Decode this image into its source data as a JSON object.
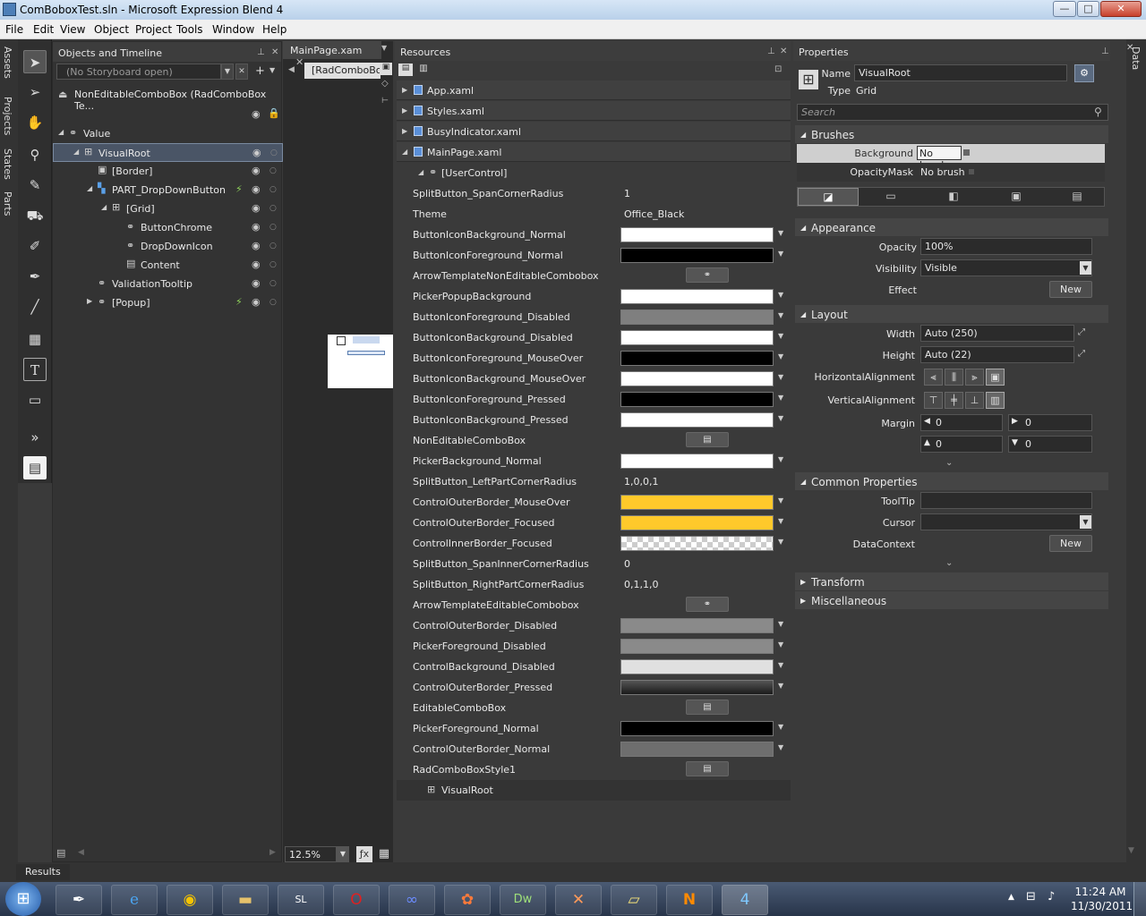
{
  "window": {
    "title": "ComBoboxTest.sln - Microsoft Expression Blend 4",
    "min": "—",
    "max": "□",
    "close": "✕"
  },
  "menu": [
    "File",
    "Edit",
    "View",
    "Object",
    "Project",
    "Tools",
    "Window",
    "Help"
  ],
  "left_tabs": [
    "Assets",
    "Projects",
    "States",
    "Parts"
  ],
  "right_tabs": [
    "Data"
  ],
  "objects": {
    "title": "Objects and Timeline",
    "storyboard": "(No Storyboard open)",
    "scope": "NonEditableComboBox (RadComboBox Te...",
    "tree": [
      {
        "label": "Value"
      },
      {
        "label": "VisualRoot"
      },
      {
        "label": "[Border]"
      },
      {
        "label": "PART_DropDownButton"
      },
      {
        "label": "[Grid]"
      },
      {
        "label": "ButtonChrome"
      },
      {
        "label": "DropDownIcon"
      },
      {
        "label": "Content"
      },
      {
        "label": "ValidationTooltip"
      },
      {
        "label": "[Popup]"
      }
    ]
  },
  "document": {
    "tab": "MainPage.xam",
    "breadcrumb": "[RadComboBo",
    "zoom": "12.5%"
  },
  "resources": {
    "title": "Resources",
    "files": [
      "App.xaml",
      "Styles.xaml",
      "BusyIndicator.xaml",
      "MainPage.xaml"
    ],
    "usercontrol": "[UserControl]",
    "rows": [
      {
        "key": "SplitButton_SpanCornerRadius",
        "kind": "text",
        "value": "1"
      },
      {
        "key": "Theme",
        "kind": "text",
        "value": "Office_Black"
      },
      {
        "key": "ButtonIconBackground_Normal",
        "kind": "swatch",
        "color": "#ffffff"
      },
      {
        "key": "ButtonIconForeground_Normal",
        "kind": "swatch",
        "color": "#000000"
      },
      {
        "key": "ArrowTemplateNonEditableCombobox",
        "kind": "button",
        "value": "⚭"
      },
      {
        "key": "PickerPopupBackground",
        "kind": "swatch",
        "color": "#ffffff"
      },
      {
        "key": "ButtonIconForeground_Disabled",
        "kind": "swatch",
        "color": "#7f7f7f"
      },
      {
        "key": "ButtonIconBackground_Disabled",
        "kind": "swatch",
        "color": "#ffffff"
      },
      {
        "key": "ButtonIconForeground_MouseOver",
        "kind": "swatch",
        "color": "#000000"
      },
      {
        "key": "ButtonIconBackground_MouseOver",
        "kind": "swatch",
        "color": "#ffffff"
      },
      {
        "key": "ButtonIconForeground_Pressed",
        "kind": "swatch",
        "color": "#000000"
      },
      {
        "key": "ButtonIconBackground_Pressed",
        "kind": "swatch",
        "color": "#ffffff"
      },
      {
        "key": "NonEditableComboBox",
        "kind": "button",
        "value": "▤"
      },
      {
        "key": "PickerBackground_Normal",
        "kind": "swatch",
        "color": "#ffffff"
      },
      {
        "key": "SplitButton_LeftPartCornerRadius",
        "kind": "text",
        "value": "1,0,0,1"
      },
      {
        "key": "ControlOuterBorder_MouseOver",
        "kind": "swatch",
        "color": "#ffc92b"
      },
      {
        "key": "ControlOuterBorder_Focused",
        "kind": "swatch",
        "color": "#ffc92b"
      },
      {
        "key": "ControlInnerBorder_Focused",
        "kind": "checker",
        "color": "transparent"
      },
      {
        "key": "SplitButton_SpanInnerCornerRadius",
        "kind": "text",
        "value": "0"
      },
      {
        "key": "SplitButton_RightPartCornerRadius",
        "kind": "text",
        "value": "0,1,1,0"
      },
      {
        "key": "ArrowTemplateEditableCombobox",
        "kind": "button",
        "value": "⚭"
      },
      {
        "key": "ControlOuterBorder_Disabled",
        "kind": "swatch",
        "color": "#8a8a8a"
      },
      {
        "key": "PickerForeground_Disabled",
        "kind": "swatch",
        "color": "#8a8a8a"
      },
      {
        "key": "ControlBackground_Disabled",
        "kind": "swatch",
        "color": "#e0e0e0"
      },
      {
        "key": "ControlOuterBorder_Pressed",
        "kind": "gradient",
        "color": "#1a1a1a"
      },
      {
        "key": "EditableComboBox",
        "kind": "button",
        "value": "▤"
      },
      {
        "key": "PickerForeground_Normal",
        "kind": "swatch",
        "color": "#000000"
      },
      {
        "key": "ControlOuterBorder_Normal",
        "kind": "swatch",
        "color": "#6e6e6e"
      },
      {
        "key": "RadComboBoxStyle1",
        "kind": "button",
        "value": "▤"
      }
    ],
    "visualroot": "VisualRoot"
  },
  "properties": {
    "title": "Properties",
    "name_label": "Name",
    "name_value": "VisualRoot",
    "type_label": "Type",
    "type_value": "Grid",
    "search_placeholder": "Search",
    "brushes": {
      "title": "Brushes",
      "background_label": "Background",
      "background_value": "No brush",
      "opacity_label": "OpacityMask",
      "opacity_value": "No brush"
    },
    "appearance": {
      "title": "Appearance",
      "opacity_label": "Opacity",
      "opacity_value": "100%",
      "visibility_label": "Visibility",
      "visibility_value": "Visible",
      "effect_label": "Effect",
      "new": "New"
    },
    "layout": {
      "title": "Layout",
      "width_label": "Width",
      "width_value": "Auto (250)",
      "height_label": "Height",
      "height_value": "Auto (22)",
      "halign_label": "HorizontalAlignment",
      "valign_label": "VerticalAlignment",
      "margin_label": "Margin",
      "m_left": "0",
      "m_right": "0",
      "m_top": "0",
      "m_bottom": "0"
    },
    "common": {
      "title": "Common Properties",
      "tooltip_label": "ToolTip",
      "cursor_label": "Cursor",
      "datacontext_label": "DataContext",
      "new": "New"
    },
    "transform": "Transform",
    "misc": "Miscellaneous"
  },
  "results": "Results",
  "clock": {
    "time": "11:24 AM",
    "date": "11/30/2011"
  }
}
